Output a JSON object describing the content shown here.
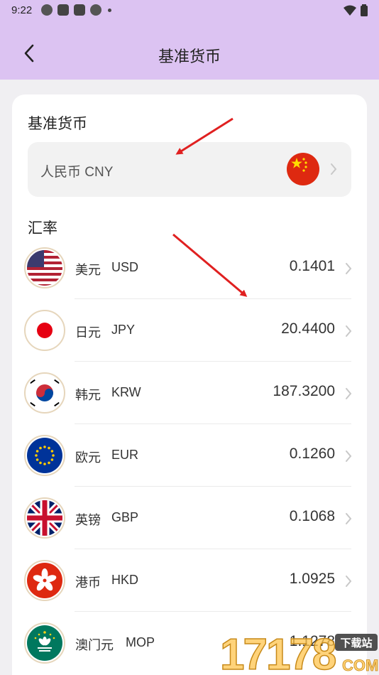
{
  "status_bar": {
    "time": "9:22"
  },
  "app_bar": {
    "title": "基准货币"
  },
  "base_section": {
    "title": "基准货币",
    "currency_label": "人民币 CNY"
  },
  "rate_section": {
    "title": "汇率",
    "rows": [
      {
        "name": "美元",
        "code": "USD",
        "value": "0.1401",
        "flag": "usa-flag-icon"
      },
      {
        "name": "日元",
        "code": "JPY",
        "value": "20.4400",
        "flag": "japan-flag-icon"
      },
      {
        "name": "韩元",
        "code": "KRW",
        "value": "187.3200",
        "flag": "korea-flag-icon"
      },
      {
        "name": "欧元",
        "code": "EUR",
        "value": "0.1260",
        "flag": "eu-flag-icon"
      },
      {
        "name": "英镑",
        "code": "GBP",
        "value": "0.1068",
        "flag": "uk-flag-icon"
      },
      {
        "name": "港币",
        "code": "HKD",
        "value": "1.0925",
        "flag": "hongkong-flag-icon"
      },
      {
        "name": "澳门元",
        "code": "MOP",
        "value": "1.1278",
        "flag": "macau-flag-icon"
      }
    ]
  },
  "watermark": {
    "site": "17178",
    "badge": "下载站",
    "suffix": "COM"
  },
  "colors": {
    "header": "#dcc3f2",
    "annotation_arrow": "#e02020",
    "background": "#f0eff2"
  }
}
